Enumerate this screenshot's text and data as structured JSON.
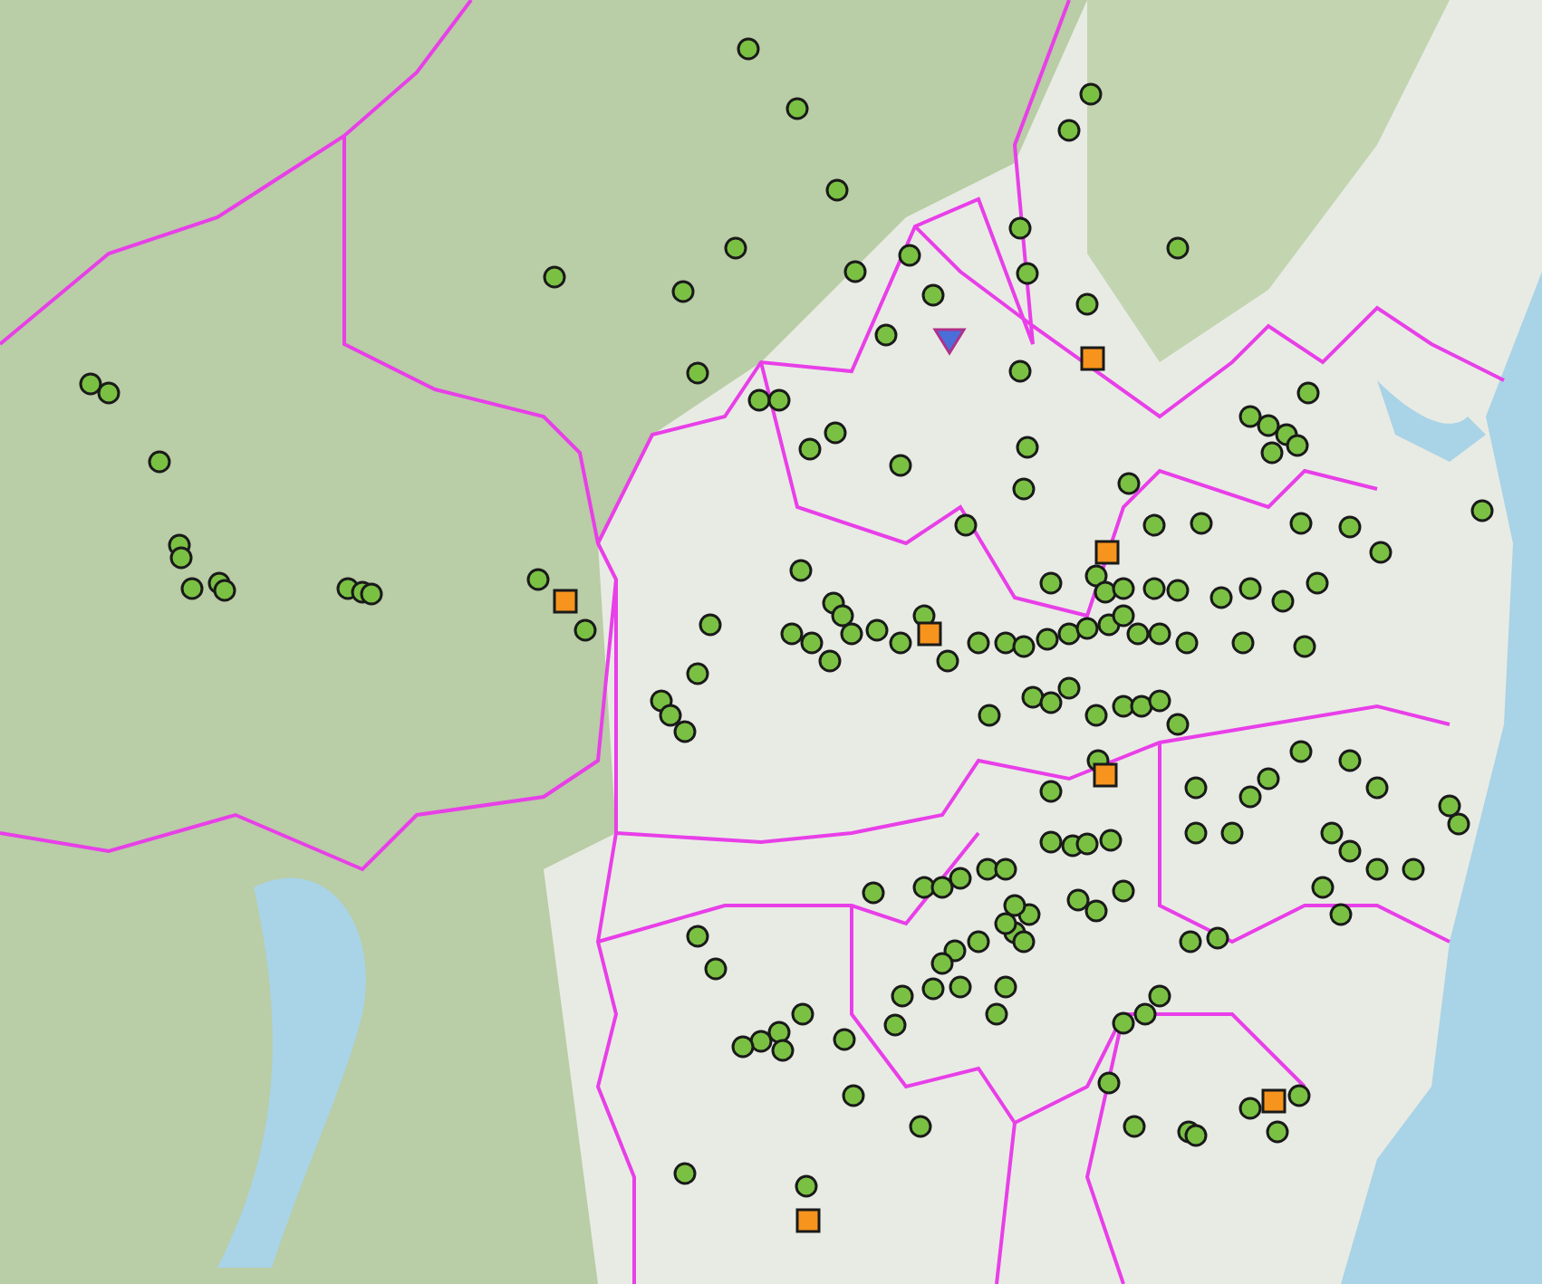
{
  "map": {
    "marker_groups": [
      {
        "kind": "circle",
        "color": "#7ac143"
      },
      {
        "kind": "square",
        "color": "#f7941d"
      },
      {
        "kind": "triangle",
        "color": "#4a6fd8"
      }
    ]
  }
}
